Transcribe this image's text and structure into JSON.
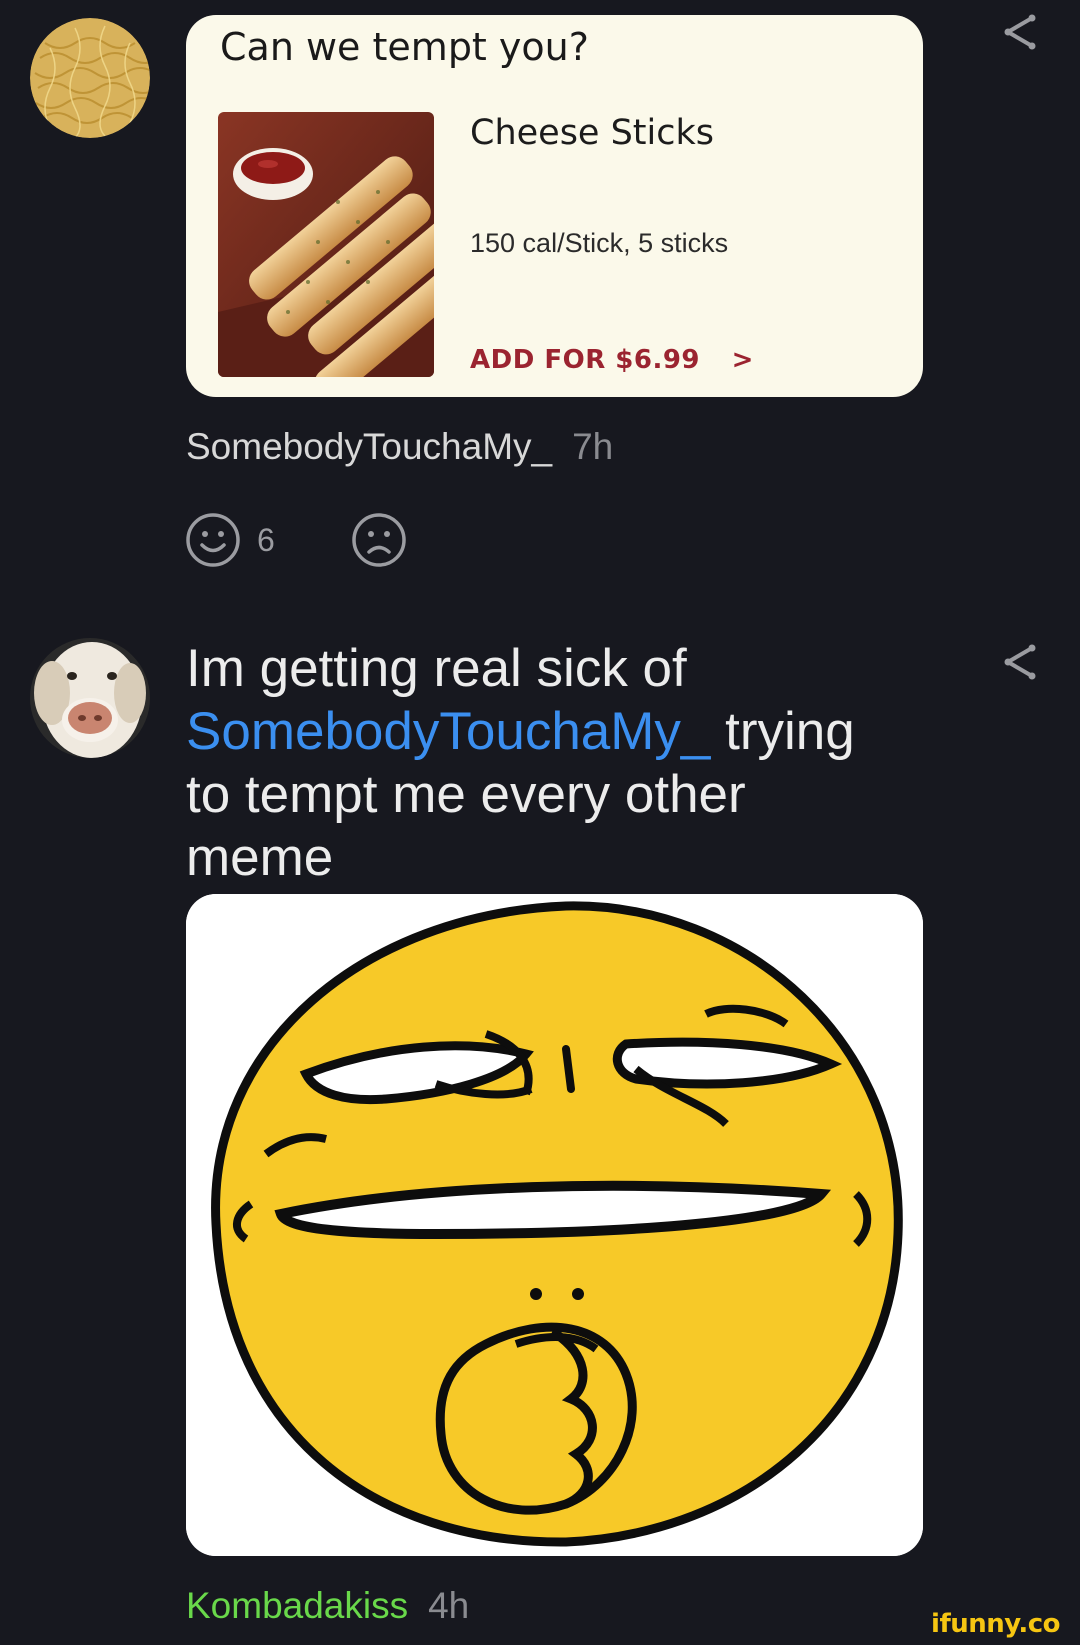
{
  "post": {
    "card_title": "Can we tempt you?",
    "product_name": "Cheese Sticks",
    "product_info": "150 cal/Stick, 5 sticks",
    "add_label": "ADD FOR $6.99",
    "add_chevron": ">",
    "username": "SomebodyTouchaMy_",
    "time": "7h",
    "smile_count": "6",
    "icons": {
      "smile": "smile-icon",
      "frown": "frown-icon",
      "share": "share-icon"
    }
  },
  "comment": {
    "text_before": "Im getting real sick of ",
    "mention": "SomebodyTouchaMy_",
    "text_after": " trying to tempt me every other meme",
    "username": "Kombadakiss",
    "time": "4h"
  },
  "colors": {
    "background": "#17181f",
    "mention": "#3b8ff0",
    "username_green": "#69d84a",
    "add_button": "#9b2430"
  },
  "watermark": "ifunny.co"
}
